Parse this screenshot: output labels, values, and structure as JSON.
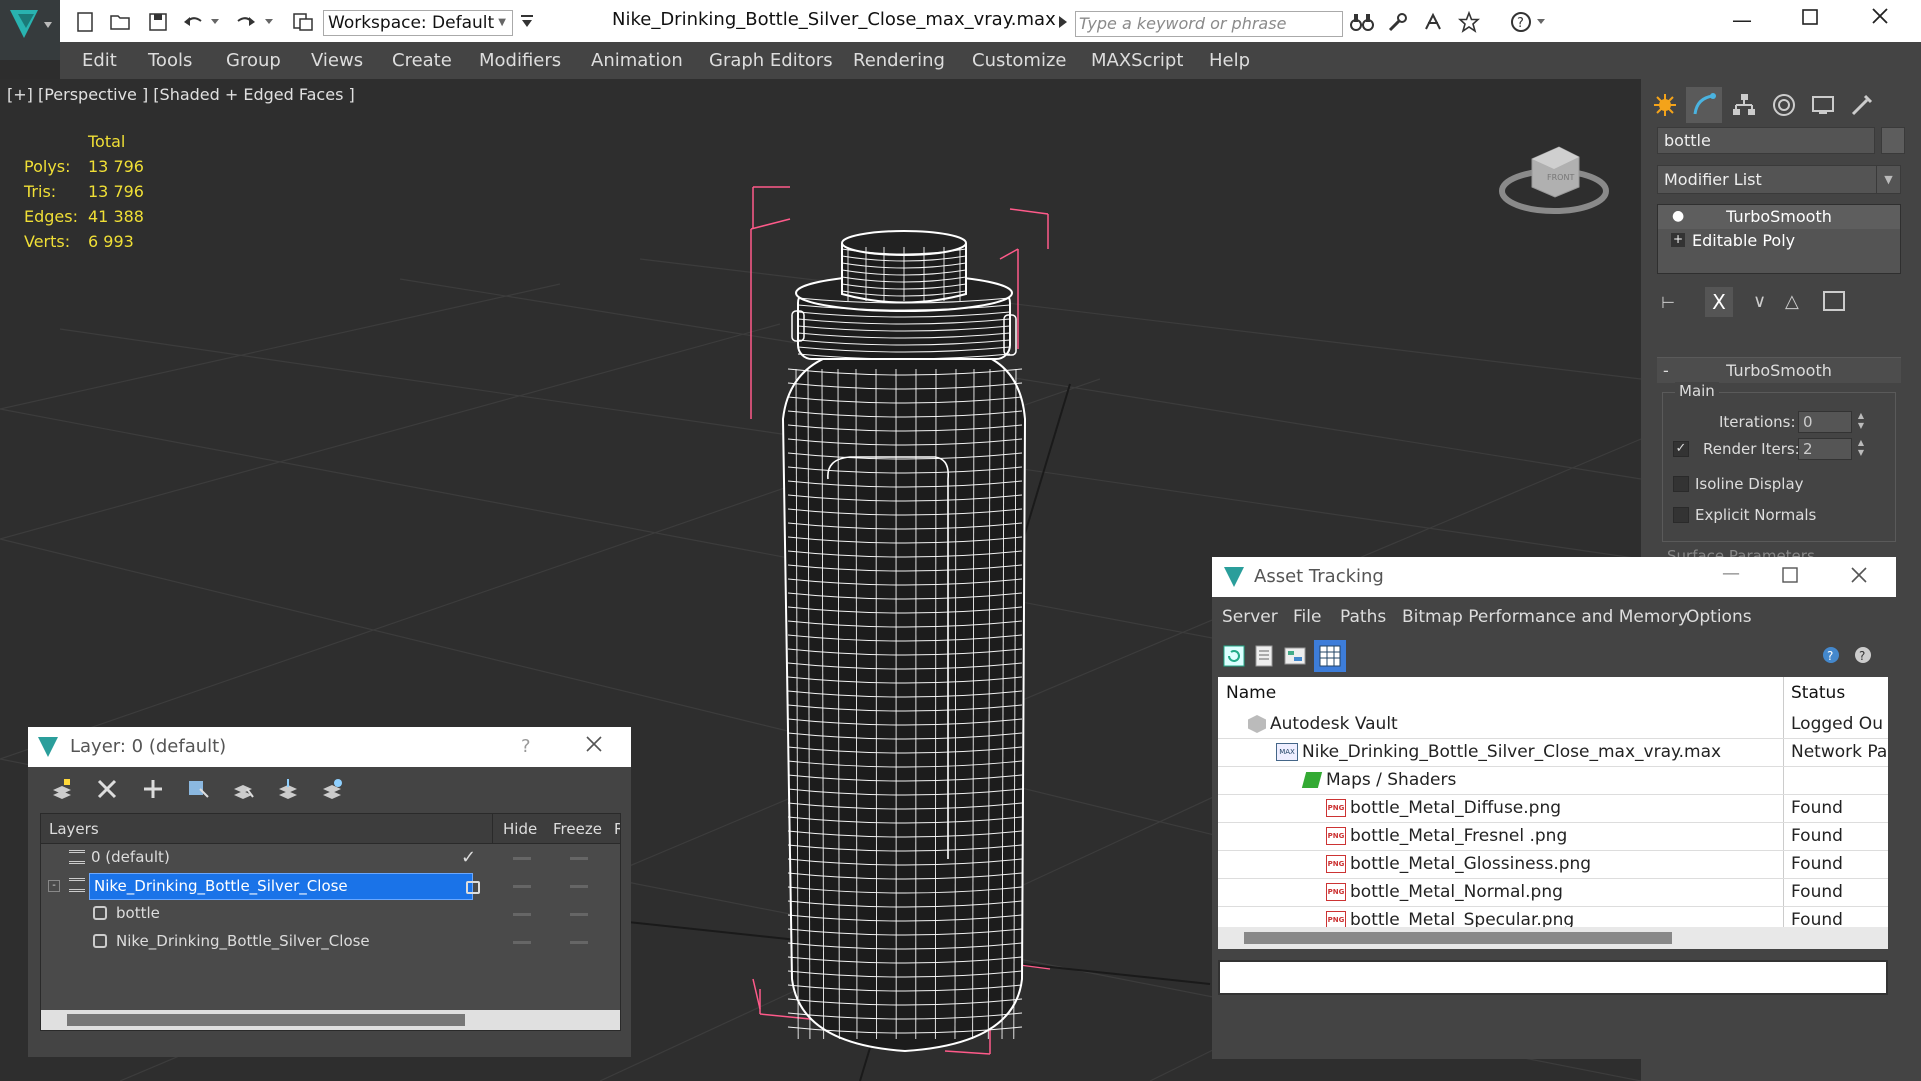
{
  "titlebar": {
    "workspace": "Workspace: Default",
    "file_title": "Nike_Drinking_Bottle_Silver_Close_max_vray.max",
    "search_placeholder": "Type a keyword or phrase"
  },
  "menu": [
    "Edit",
    "Tools",
    "Group",
    "Views",
    "Create",
    "Modifiers",
    "Animation",
    "Graph Editors",
    "Rendering",
    "Customize",
    "MAXScript",
    "Help"
  ],
  "viewport": {
    "label": "[+] [Perspective ] [Shaded + Edged Faces ]",
    "stats_header": "Total",
    "stats": [
      {
        "label": "Polys:",
        "value": "13 796"
      },
      {
        "label": "Tris:",
        "value": "13 796"
      },
      {
        "label": "Edges:",
        "value": "41 388"
      },
      {
        "label": "Verts:",
        "value": "6 993"
      }
    ],
    "viewcube_label": "FRONT"
  },
  "command_panel": {
    "object_name": "bottle",
    "modifier_list": "Modifier List",
    "stack": [
      "TurboSmooth",
      "Editable Poly"
    ],
    "rollout_title": "TurboSmooth",
    "group_main": "Main",
    "iterations_label": "Iterations:",
    "iterations_value": "0",
    "render_iters_label": "Render Iters:",
    "render_iters_value": "2",
    "render_iters_checked": true,
    "isoline_label": "Isoline Display",
    "explicit_normals_label": "Explicit Normals",
    "surface_params_label": "Surface Parameters"
  },
  "layer_window": {
    "title": "Layer: 0 (default)",
    "help": "?",
    "columns": {
      "layers": "Layers",
      "hide": "Hide",
      "freeze": "Freeze",
      "render": "R"
    },
    "rows": [
      {
        "name": "0 (default)",
        "indent": 1,
        "type": "layer",
        "selected": false
      },
      {
        "name": "Nike_Drinking_Bottle_Silver_Close",
        "indent": 1,
        "type": "layer",
        "selected": true
      },
      {
        "name": "bottle",
        "indent": 2,
        "type": "object",
        "selected": false
      },
      {
        "name": "Nike_Drinking_Bottle_Silver_Close",
        "indent": 2,
        "type": "object",
        "selected": false
      }
    ]
  },
  "asset_window": {
    "title": "Asset Tracking",
    "menu": [
      "Server",
      "File",
      "Paths",
      "Bitmap Performance and Memory",
      "Options"
    ],
    "columns": {
      "name": "Name",
      "status": "Status"
    },
    "rows": [
      {
        "name": "Autodesk Vault",
        "status": "Logged Ou",
        "indent": 1,
        "icon": "vault"
      },
      {
        "name": "Nike_Drinking_Bottle_Silver_Close_max_vray.max",
        "status": "Network Pa",
        "indent": 2,
        "icon": "max"
      },
      {
        "name": "Maps / Shaders",
        "status": "",
        "indent": 3,
        "icon": "folder"
      },
      {
        "name": "bottle_Metal_Diffuse.png",
        "status": "Found",
        "indent": 4,
        "icon": "png"
      },
      {
        "name": "bottle_Metal_Fresnel .png",
        "status": "Found",
        "indent": 4,
        "icon": "png"
      },
      {
        "name": "bottle_Metal_Glossiness.png",
        "status": "Found",
        "indent": 4,
        "icon": "png"
      },
      {
        "name": "bottle_Metal_Normal.png",
        "status": "Found",
        "indent": 4,
        "icon": "png"
      },
      {
        "name": "bottle_Metal_Specular.png",
        "status": "Found",
        "indent": 4,
        "icon": "png"
      }
    ]
  },
  "colors": {
    "selection": "#1a73e8",
    "stats_text": "#f0df36",
    "bbox": "#ff5a8a",
    "wire": "#ffffff"
  }
}
